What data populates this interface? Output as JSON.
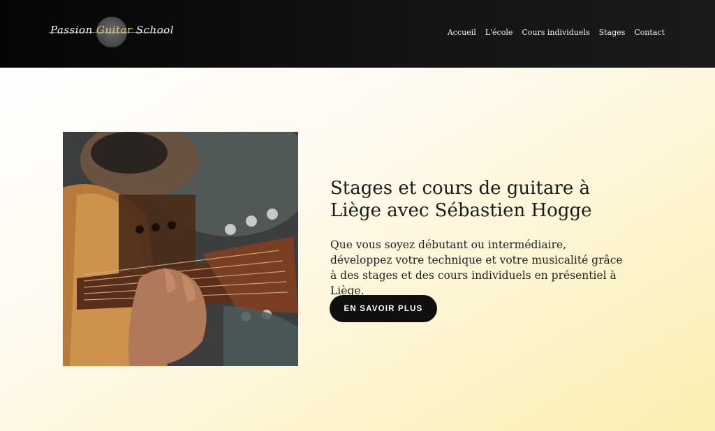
{
  "header": {
    "logo": {
      "text_start": "Passion ",
      "text_mid": "Guitar",
      "text_end": " School"
    },
    "nav": [
      {
        "label": "Accueil"
      },
      {
        "label": "L'école"
      },
      {
        "label": "Cours individuels"
      },
      {
        "label": "Stages"
      },
      {
        "label": "Contact"
      }
    ]
  },
  "hero": {
    "title": "Stages et cours de guitare à Liège avec Sébastien Hogge",
    "description": "Que vous soyez débutant ou intermédiaire, développez votre technique et votre musicalité grâce à des stages et des cours individuels en présentiel à Liège.",
    "cta_label": "EN SAVOIR PLUS",
    "image": "photo of a man playing an acoustic guitar"
  },
  "colors": {
    "header_bg": "#0d0d0d",
    "hero_gradient_start": "#ffffff",
    "hero_gradient_end": "#fbeeb0",
    "button_bg": "#0f0f0f",
    "button_text": "#ffffff",
    "text": "#1a1a1a"
  }
}
